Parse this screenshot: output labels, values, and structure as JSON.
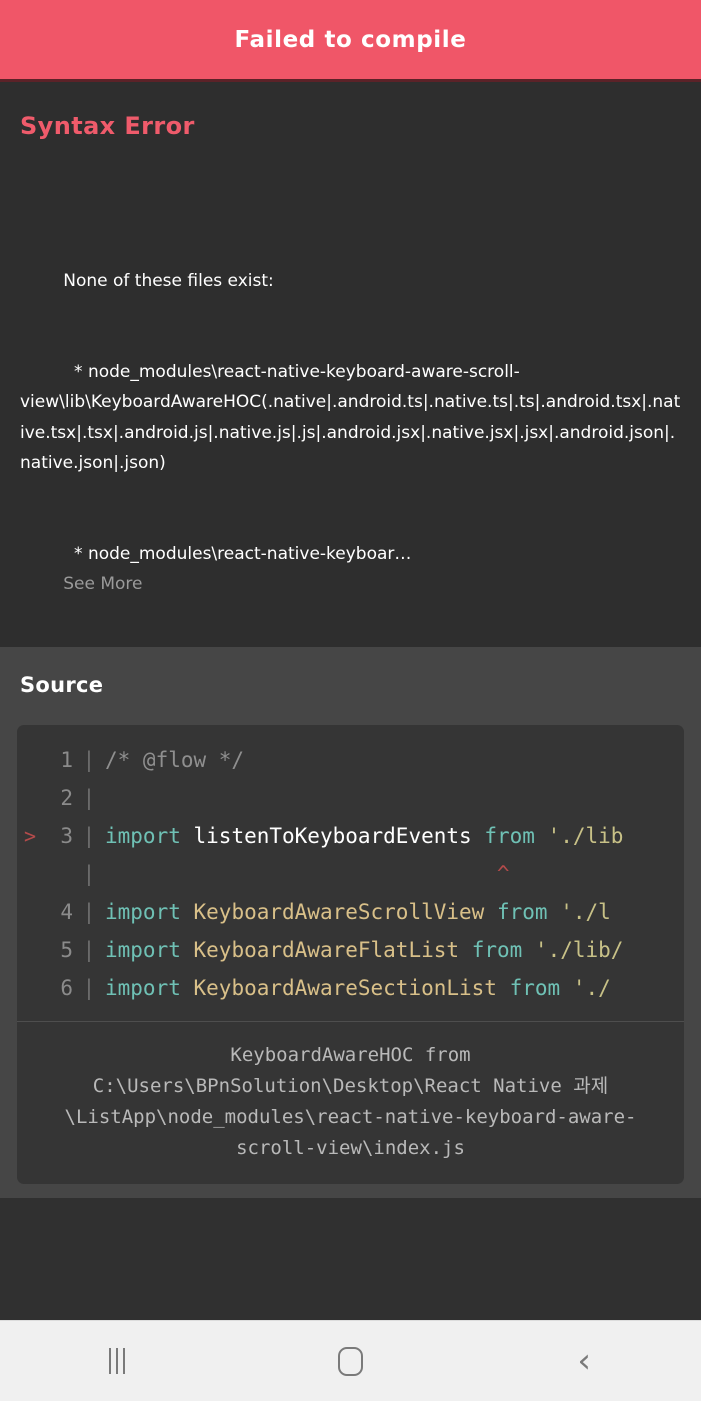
{
  "header": {
    "title": "Failed to compile",
    "bg_color": "#f05668",
    "text_color": "#ffffff"
  },
  "error": {
    "title": "Syntax Error",
    "title_color": "#ef5b6b",
    "intro": "None of these files exist:",
    "bullet_1": "  * node_modules\\react-native-keyboard-aware-scroll-view\\lib\\KeyboardAwareHOC(.native|.android.ts|.native.ts|.ts|.android.tsx|.native.tsx|.tsx|.android.js|.native.js|.js|.android.jsx|.native.jsx|.jsx|.android.json|.native.json|.json)",
    "bullet_2": "  * node_modules\\react-native-keyboar…",
    "see_more_label": "See More",
    "see_more_color": "#9a9a9a"
  },
  "source": {
    "heading": "Source",
    "code_lines": [
      {
        "marker": "",
        "number": "1",
        "pipe": "|",
        "tokens": [
          {
            "text": "/* @flow */",
            "type": "cmt"
          }
        ]
      },
      {
        "marker": "",
        "number": "2",
        "pipe": "|",
        "tokens": []
      },
      {
        "marker": ">",
        "number": "3",
        "pipe": "|",
        "tokens": [
          {
            "text": "import",
            "type": "kw"
          },
          {
            "text": " ",
            "type": "plain"
          },
          {
            "text": "listenToKeyboardEvents",
            "type": "ident"
          },
          {
            "text": " ",
            "type": "plain"
          },
          {
            "text": "from",
            "type": "kw"
          },
          {
            "text": " ",
            "type": "plain"
          },
          {
            "text": "'./lib",
            "type": "str"
          }
        ]
      },
      {
        "marker": "",
        "number": "",
        "pipe": "|",
        "caret": "                               ^",
        "tokens": []
      },
      {
        "marker": "",
        "number": "4",
        "pipe": "|",
        "tokens": [
          {
            "text": "import",
            "type": "kw"
          },
          {
            "text": " ",
            "type": "plain"
          },
          {
            "text": "KeyboardAwareScrollView",
            "type": "name"
          },
          {
            "text": " ",
            "type": "plain"
          },
          {
            "text": "from",
            "type": "kw"
          },
          {
            "text": " ",
            "type": "plain"
          },
          {
            "text": "'./l",
            "type": "str"
          }
        ]
      },
      {
        "marker": "",
        "number": "5",
        "pipe": "|",
        "tokens": [
          {
            "text": "import",
            "type": "kw"
          },
          {
            "text": " ",
            "type": "plain"
          },
          {
            "text": "KeyboardAwareFlatList",
            "type": "name"
          },
          {
            "text": " ",
            "type": "plain"
          },
          {
            "text": "from",
            "type": "kw"
          },
          {
            "text": " ",
            "type": "plain"
          },
          {
            "text": "'./lib/",
            "type": "str"
          }
        ]
      },
      {
        "marker": "",
        "number": "6",
        "pipe": "|",
        "tokens": [
          {
            "text": "import",
            "type": "kw"
          },
          {
            "text": " ",
            "type": "plain"
          },
          {
            "text": "KeyboardAwareSectionList",
            "type": "name"
          },
          {
            "text": " ",
            "type": "plain"
          },
          {
            "text": "from",
            "type": "kw"
          },
          {
            "text": " ",
            "type": "plain"
          },
          {
            "text": "'./",
            "type": "str"
          }
        ]
      }
    ],
    "footer": "KeyboardAwareHOC from\nC:\\Users\\BPnSolution\\Desktop\\React Native 과제\\ListApp\\node_modules\\react-native-keyboard-aware-scroll-view\\index.js"
  },
  "nav_bar": {
    "recents_label": "recent-apps",
    "home_label": "home",
    "back_label": "back",
    "back_glyph": "‹",
    "icon_color": "#7a7a7a",
    "bg_color": "#f0f0f0"
  }
}
